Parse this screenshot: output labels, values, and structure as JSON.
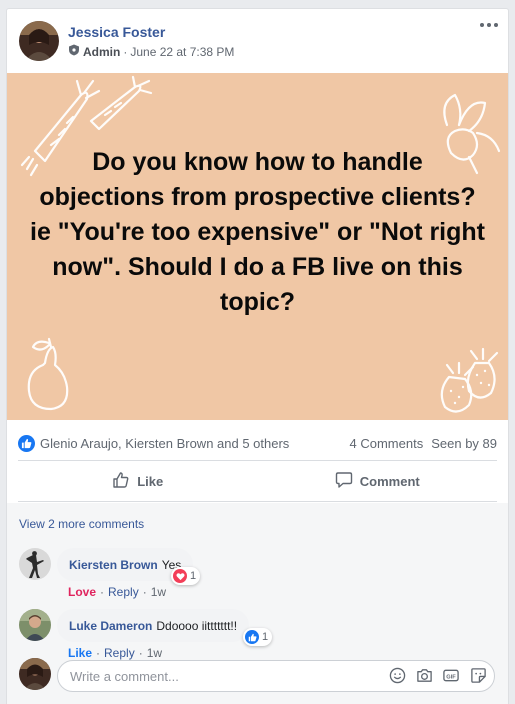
{
  "post": {
    "author": "Jessica Foster",
    "role": "Admin",
    "separator": "·",
    "timestamp": "June 22 at 7:38 PM",
    "text": "Do you know how to handle objections from prospective clients? ie \"You're too expensive\" or \"Not right now\". Should I do a FB live on this topic?",
    "background_color": "#f0c7a5"
  },
  "reactions": {
    "summary": "Glenio Araujo, Kiersten Brown and 5 others",
    "comments_count": "4 Comments",
    "seen_by": "Seen by 89"
  },
  "actions": {
    "like_label": "Like",
    "comment_label": "Comment"
  },
  "comments": {
    "view_more": "View 2 more comments",
    "items": [
      {
        "name": "Kiersten Brown",
        "text": "Yes",
        "reaction_label": "Love",
        "reply_label": "Reply",
        "dot": "·",
        "age": "1w",
        "reaction_count": "1",
        "reaction_icon": "heart-icon"
      },
      {
        "name": "Luke Dameron",
        "text": "Ddoooo iittttttt!!",
        "reaction_label": "Like",
        "reply_label": "Reply",
        "dot": "·",
        "age": "1w",
        "reaction_count": "1",
        "reaction_icon": "thumbs-up-icon"
      }
    ]
  },
  "composer": {
    "placeholder": "Write a comment...",
    "icons": [
      "emoji-icon",
      "camera-icon",
      "gif-icon",
      "sticker-icon"
    ]
  },
  "colors": {
    "link": "#385898",
    "facebook_blue": "#1877f2",
    "love_red": "#e0245e"
  }
}
